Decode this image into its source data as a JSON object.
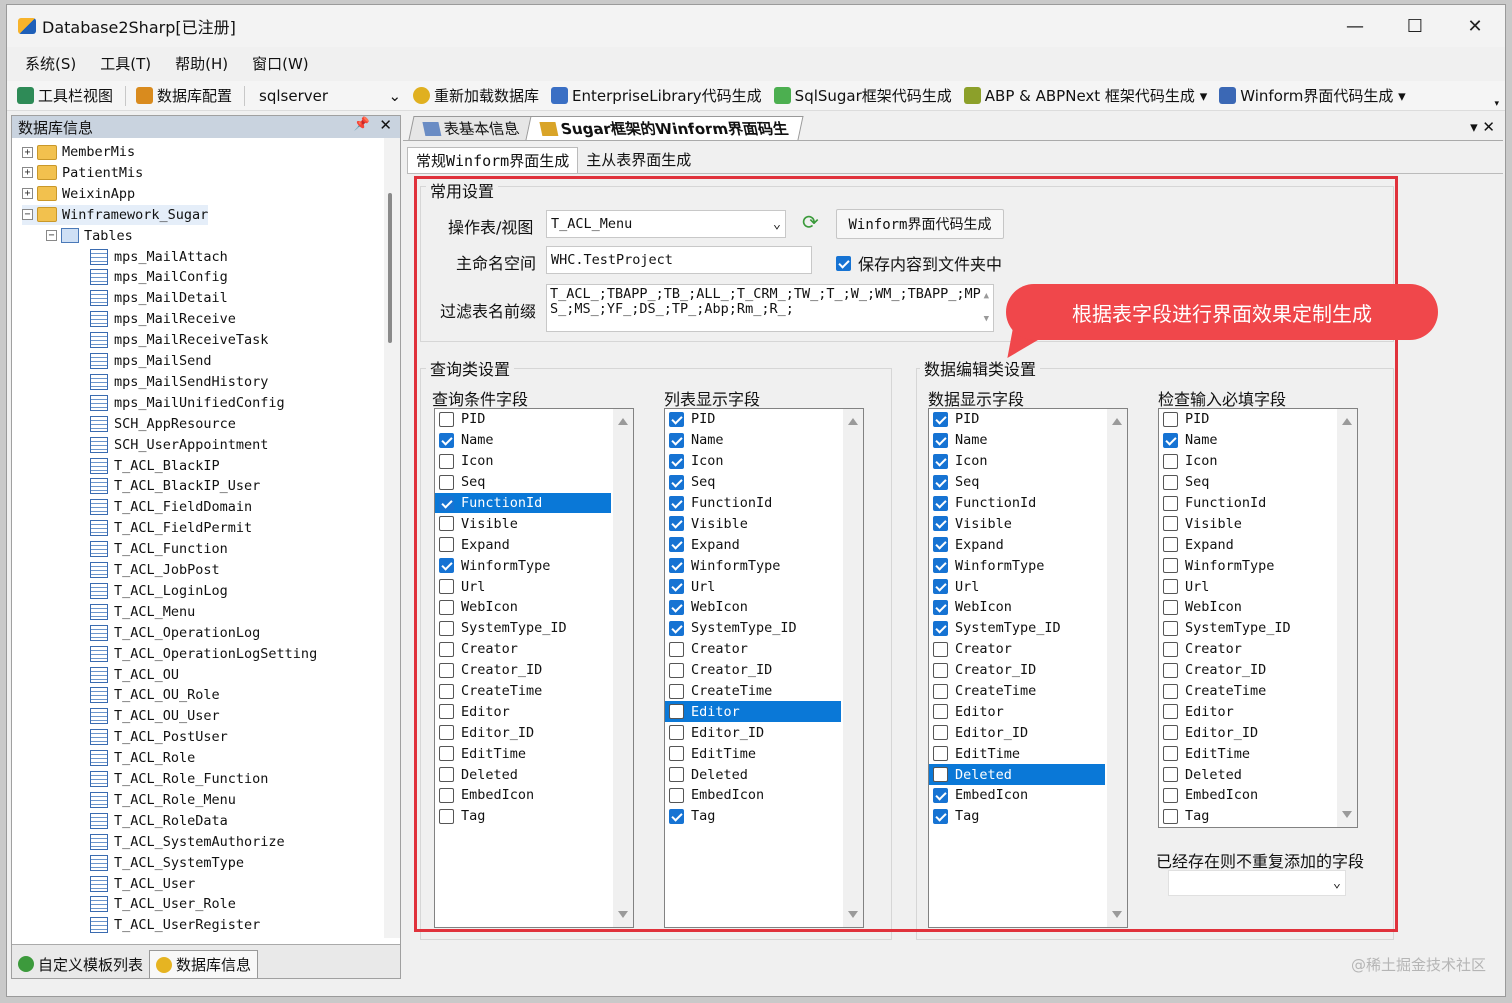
{
  "window": {
    "title": "Database2Sharp[已注册]",
    "controls": [
      "—",
      "☐",
      "✕"
    ]
  },
  "menu": [
    "系统(S)",
    "工具(T)",
    "帮助(H)",
    "窗口(W)"
  ],
  "toolbar": {
    "items": [
      {
        "label": "工具栏视图",
        "color": "#2e8b57"
      },
      {
        "label": "数据库配置",
        "color": "#d98b1e"
      }
    ],
    "dbtype": "sqlserver",
    "items2": [
      {
        "label": "重新加载数据库",
        "color": "#e0b020"
      },
      {
        "label": "EnterpriseLibrary代码生成",
        "color": "#3a6fc4"
      },
      {
        "label": "SqlSugar框架代码生成",
        "color": "#4caf50"
      },
      {
        "label": "ABP & ABPNext 框架代码生成 ▾",
        "color": "#8ca02a"
      },
      {
        "label": "Winform界面代码生成 ▾",
        "color": "#3b68b5"
      }
    ]
  },
  "leftpanel": {
    "title": "数据库信息",
    "dbs": [
      "MemberMis",
      "PatientMis",
      "WeixinApp",
      "Winframework_Sugar"
    ],
    "tables_label": "Tables",
    "tables": [
      "mps_MailAttach",
      "mps_MailConfig",
      "mps_MailDetail",
      "mps_MailReceive",
      "mps_MailReceiveTask",
      "mps_MailSend",
      "mps_MailSendHistory",
      "mps_MailUnifiedConfig",
      "SCH_AppResource",
      "SCH_UserAppointment",
      "T_ACL_BlackIP",
      "T_ACL_BlackIP_User",
      "T_ACL_FieldDomain",
      "T_ACL_FieldPermit",
      "T_ACL_Function",
      "T_ACL_JobPost",
      "T_ACL_LoginLog",
      "T_ACL_Menu",
      "T_ACL_OperationLog",
      "T_ACL_OperationLogSetting",
      "T_ACL_OU",
      "T_ACL_OU_Role",
      "T_ACL_OU_User",
      "T_ACL_PostUser",
      "T_ACL_Role",
      "T_ACL_Role_Function",
      "T_ACL_Role_Menu",
      "T_ACL_RoleData",
      "T_ACL_SystemAuthorize",
      "T_ACL_SystemType",
      "T_ACL_User",
      "T_ACL_User_Role",
      "T_ACL_UserRegister"
    ],
    "tabs": [
      "自定义模板列表",
      "数据库信息"
    ]
  },
  "doc_tabs": [
    "表基本信息",
    "Sugar框架的Winform界面码生"
  ],
  "inner_tabs": [
    "常规Winform界面生成",
    "主从表界面生成"
  ],
  "common": {
    "title": "常用设置",
    "table_label": "操作表/视图",
    "table_value": "T_ACL_Menu",
    "gen_button": "Winform界面代码生成",
    "ns_label": "主命名空间",
    "ns_value": "WHC.TestProject",
    "save_label": "保存内容到文件夹中",
    "filter_label": "过滤表名前缀",
    "filter_line1": "T_ACL_;TBAPP_;TB_;ALL_;T_CRM_;TW_;T_;W_;WM_;TBAPP_;MP",
    "filter_line2": "S_;MS_;YF_;DS_;TP_;Abp;Rm_;R_;"
  },
  "query": {
    "title": "查询类设置",
    "col1": "查询条件字段",
    "col2": "列表显示字段"
  },
  "edit": {
    "title": "数据编辑类设置",
    "col1": "数据显示字段",
    "col2": "检查输入必填字段",
    "exist_label": "已经存在则不重复添加的字段"
  },
  "fields": [
    "PID",
    "Name",
    "Icon",
    "Seq",
    "FunctionId",
    "Visible",
    "Expand",
    "WinformType",
    "Url",
    "WebIcon",
    "SystemType_ID",
    "Creator",
    "Creator_ID",
    "CreateTime",
    "Editor",
    "Editor_ID",
    "EditTime",
    "Deleted",
    "EmbedIcon",
    "Tag"
  ],
  "lists": [
    {
      "checked": [
        1,
        4,
        7
      ],
      "selected": 4
    },
    {
      "checked": [
        0,
        1,
        2,
        3,
        4,
        5,
        6,
        7,
        8,
        9,
        10,
        19
      ],
      "selected": 14
    },
    {
      "checked": [
        0,
        1,
        2,
        3,
        4,
        5,
        6,
        7,
        8,
        9,
        10,
        18,
        19
      ],
      "selected": 17
    },
    {
      "checked": [
        1
      ],
      "selected": -1
    }
  ],
  "callout": "根据表字段进行界面效果定制生成",
  "watermark": "@稀土掘金技术社区"
}
